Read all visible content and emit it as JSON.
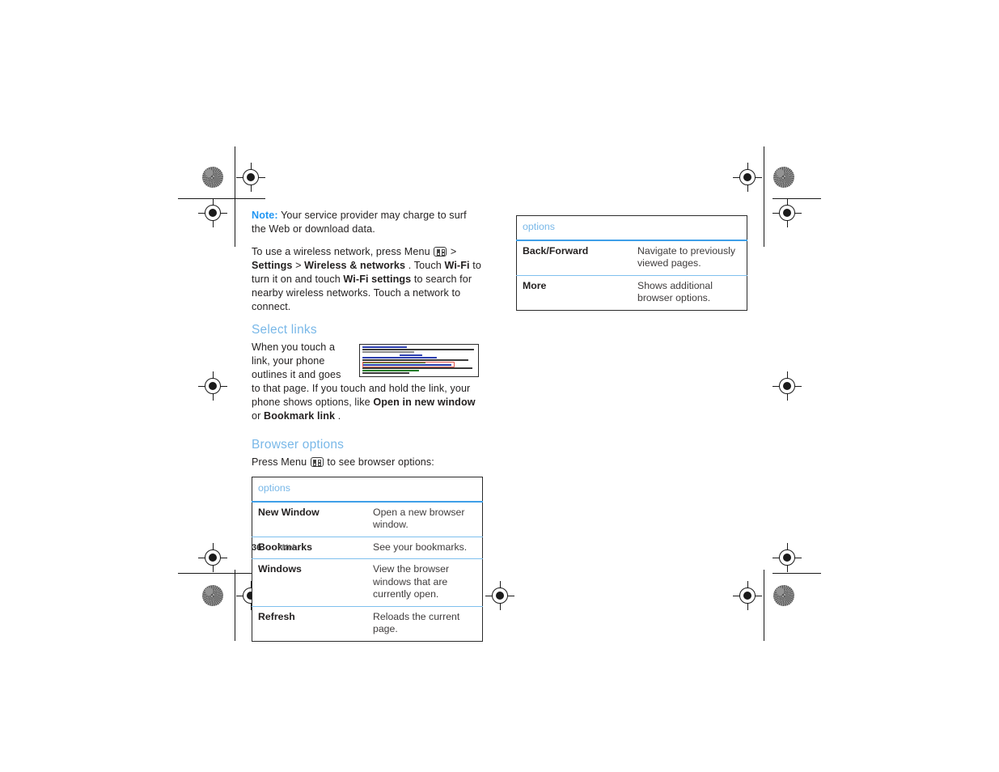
{
  "page": {
    "number": "36",
    "section_label": "Web"
  },
  "left_column": {
    "note": {
      "label": "Note:",
      "text": "Your service provider may charge to surf the Web or download data.",
      "label_color": "#2196f3"
    },
    "wireless_paragraph": {
      "part1": "To use a wireless network, press Menu ",
      "menu_icon": "menu-key-icon",
      "part2": " > ",
      "bold1": "Settings",
      "part3": " > ",
      "bold2": "Wireless & networks",
      "part4": ". Touch ",
      "bold3": "Wi-Fi",
      "part5": " to turn it on and touch ",
      "bold4": "Wi-Fi settings",
      "part6": " to search for nearby wireless networks. Touch a network to connect."
    },
    "select_links": {
      "heading": "Select links",
      "heading_color": "#79b8e8",
      "text1": "When you touch a link, your phone outlines it and goes to that page. If you touch and hold the link, your phone shows options, like ",
      "bold1": "Open in new window",
      "mid": " or ",
      "bold2": "Bookmark link",
      "end": ".",
      "thumbnail_name": "browser-page-thumbnail"
    },
    "browser_options": {
      "heading": "Browser options",
      "heading_color": "#79b8e8",
      "intro_before": "Press Menu ",
      "intro_after": " to see browser options:",
      "table": {
        "header": "options",
        "rows": [
          {
            "option": "New Window",
            "description": "Open a new browser window."
          },
          {
            "option": "Bookmarks",
            "description": "See your bookmarks."
          },
          {
            "option": "Windows",
            "description": "View the browser windows that are currently open."
          },
          {
            "option": "Refresh",
            "description": "Reloads the current page."
          }
        ]
      }
    }
  },
  "right_column": {
    "table": {
      "header": "options",
      "rows": [
        {
          "option": "Back/Forward",
          "description": "Navigate to previously viewed pages."
        },
        {
          "option": "More",
          "description": "Shows additional browser options."
        }
      ]
    }
  },
  "colors": {
    "accent_blue": "#79b8e8",
    "note_blue": "#2196f3",
    "rule_blue": "#3f9fe8",
    "row_rule_blue": "#7fc0ee",
    "text": "#221f1f",
    "border": "#2b2b2b"
  }
}
